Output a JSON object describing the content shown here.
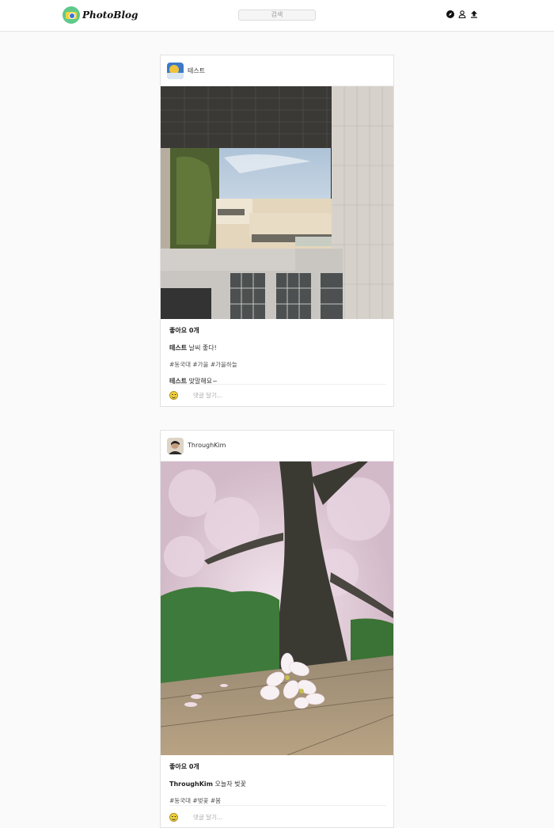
{
  "header": {
    "logo_text": "PhotoBlog",
    "search_placeholder": "검색",
    "icons": [
      "compass-icon",
      "user-icon",
      "upload-icon"
    ]
  },
  "posts": [
    {
      "username": "테스트",
      "likes": "좋아요 0개",
      "caption_user": "테스트",
      "caption_text": " 날씨 좋다!",
      "tags": "#동국대 #가을 #가을하늘",
      "comment_user": "테스트",
      "comment_text": " 맞말해요~",
      "comment_placeholder": "댓글 달기...",
      "photo": "campus-building-photo"
    },
    {
      "username": "ThroughKim",
      "likes": "좋아요 0개",
      "caption_user": "ThroughKim",
      "caption_text": " 오늘자 벚꽃",
      "tags": "#동국대 #벚꽃 #봄",
      "comment_placeholder": "댓글 달기...",
      "photo": "cherry-blossom-photo"
    }
  ]
}
